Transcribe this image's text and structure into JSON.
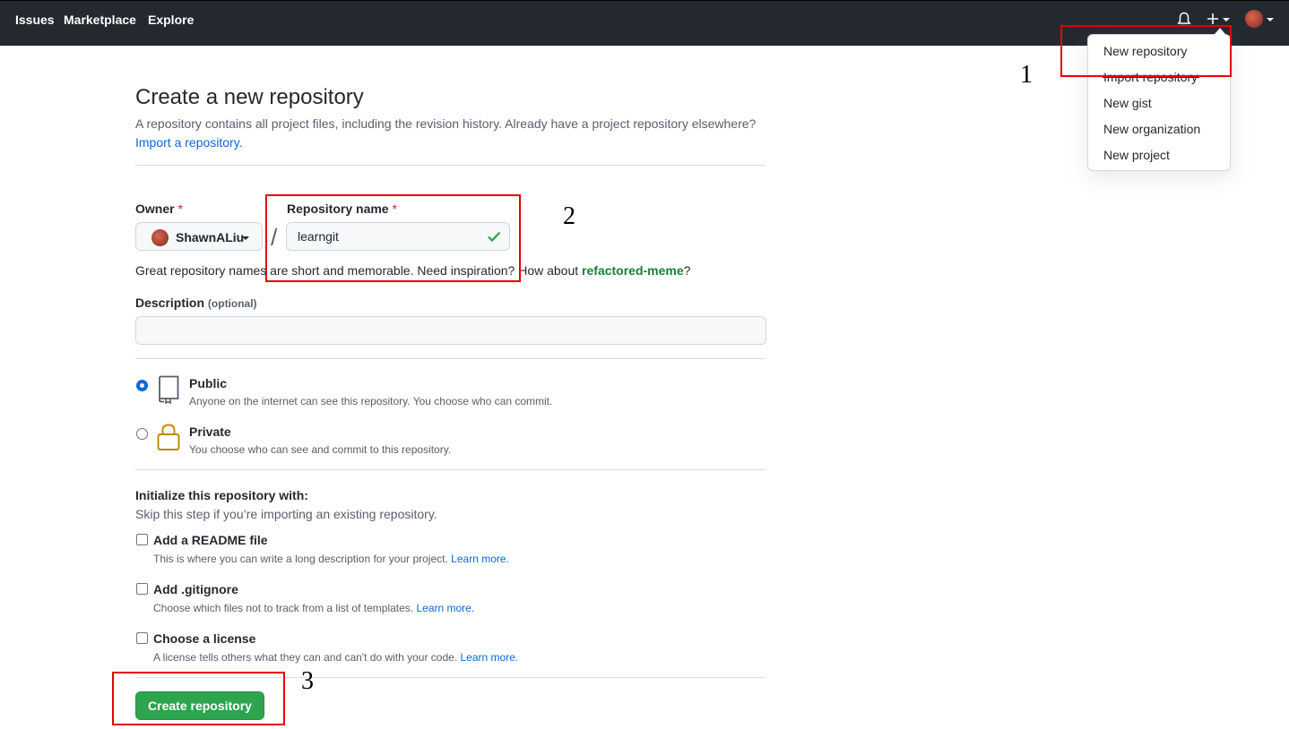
{
  "header": {
    "nav": [
      "Issues",
      "Marketplace",
      "Explore"
    ],
    "icons": [
      "bell-icon",
      "plus-icon",
      "avatar"
    ]
  },
  "dropdown": {
    "items": [
      "New repository",
      "Import repository",
      "New gist",
      "New organization",
      "New project"
    ]
  },
  "annotations": {
    "step1": "1",
    "step2": "2",
    "step3": "3",
    "highlight_color": "#e60000"
  },
  "page": {
    "title": "Create a new repository",
    "subtitle": "A repository contains all project files, including the revision history. Already have a project repository elsewhere?",
    "import_link": "Import a repository."
  },
  "form": {
    "owner_label": "Owner",
    "required_mark": "*",
    "owner_value": "ShawnALiu",
    "separator": "/",
    "repo_label": "Repository name",
    "repo_value": "learngit",
    "hint_prefix": "Great repository names are short and memorable. Need inspiration? How about",
    "hint_suggestion": "refactored-meme",
    "hint_suffix": "?",
    "description_label": "Description",
    "description_optional": "(optional)",
    "description_value": ""
  },
  "visibility": {
    "selected": "Public",
    "options": [
      {
        "title": "Public",
        "desc": "Anyone on the internet can see this repository. You choose who can commit."
      },
      {
        "title": "Private",
        "desc": "You choose who can see and commit to this repository."
      }
    ]
  },
  "initialize": {
    "title": "Initialize this repository with:",
    "subtitle": "Skip this step if you’re importing an existing repository.",
    "learn_more": "Learn more.",
    "options": [
      {
        "title": "Add a README file",
        "desc": "This is where you can write a long description for your project.",
        "checked": false
      },
      {
        "title": "Add .gitignore",
        "desc": "Choose which files not to track from a list of templates.",
        "checked": false
      },
      {
        "title": "Choose a license",
        "desc": "A license tells others what they can and can't do with your code.",
        "checked": false
      }
    ]
  },
  "submit": {
    "label": "Create repository"
  },
  "colors": {
    "header_bg": "#24292f",
    "link": "#0969da",
    "primary_button": "#2da44e",
    "suggestion": "#1a7f37",
    "required": "#cf222e"
  }
}
